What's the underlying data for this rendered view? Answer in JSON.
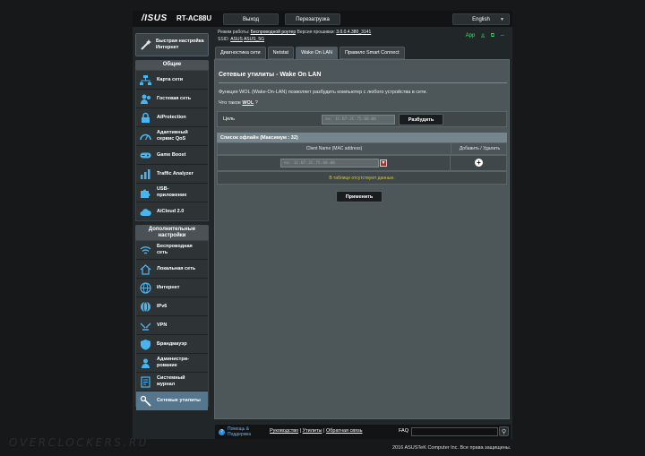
{
  "header": {
    "brand": "/ISUS",
    "model": "RT-AC88U",
    "logout_label": "Выход",
    "reboot_label": "Перезагрузка",
    "language": "English",
    "status": {
      "mode_label": "Режим работы:",
      "mode_value": "Беспроводной роутер",
      "fw_label": "Версия прошивки:",
      "fw_value": "3.0.0.4.380_3141",
      "ssid_label": "SSID:",
      "ssid_values": [
        "ASUS",
        "ASUS_5G"
      ],
      "app_label": "App"
    }
  },
  "quick_setup": {
    "label_line1": "Быстрая настройка",
    "label_line2": "Интернет"
  },
  "sidebar": {
    "general_title": "Общие",
    "general_items": [
      {
        "line1": "Карта сети",
        "line2": "",
        "icon": "network-map-icon"
      },
      {
        "line1": "Гостевая сеть",
        "line2": "",
        "icon": "guest-network-icon"
      },
      {
        "line1": "AiProtection",
        "line2": "",
        "icon": "aiprotection-lock-icon"
      },
      {
        "line1": "Адаптивный",
        "line2": "сервис QoS",
        "icon": "qos-gauge-icon"
      },
      {
        "line1": "Game Boost",
        "line2": "",
        "icon": "gamepad-icon"
      },
      {
        "line1": "Traffic Analyzer",
        "line2": "",
        "icon": "traffic-analyzer-icon"
      },
      {
        "line1": "USB-",
        "line2": "приложение",
        "icon": "usb-puzzle-icon"
      },
      {
        "line1": "AiCloud 2.0",
        "line2": "",
        "icon": "cloud-icon"
      }
    ],
    "advanced_title_line1": "Дополнительные",
    "advanced_title_line2": "настройки",
    "advanced_items": [
      {
        "line1": "Беспроводная",
        "line2": "сеть",
        "icon": "wifi-icon"
      },
      {
        "line1": "Локальная сеть",
        "line2": "",
        "icon": "home-icon"
      },
      {
        "line1": "Интернет",
        "line2": "",
        "icon": "globe-icon"
      },
      {
        "line1": "IPv6",
        "line2": "",
        "icon": "ipv6-globe-icon"
      },
      {
        "line1": "VPN",
        "line2": "",
        "icon": "vpn-icon"
      },
      {
        "line1": "Брандмауэр",
        "line2": "",
        "icon": "firewall-shield-icon"
      },
      {
        "line1": "Администри-",
        "line2": "рование",
        "icon": "admin-user-icon"
      },
      {
        "line1": "Системный",
        "line2": "журнал",
        "icon": "system-log-icon"
      },
      {
        "line1": "Сетевые утилиты",
        "line2": "",
        "icon": "network-tools-icon"
      }
    ]
  },
  "tabs": [
    "Диагностика сети",
    "Netstat",
    "Wake On LAN",
    "Правило Smart Connect"
  ],
  "main": {
    "title": "Сетевые утилиты - Wake On LAN",
    "description": "Функция WOL (Wake-On-LAN) позволяет разбудить компьютер с любого устройства в сети.",
    "wol_question_prefix": "Что такое",
    "wol_question_link": "WOL",
    "wol_question_suffix": "?",
    "target_label": "Цель",
    "target_placeholder": "ex: 1C:B7:2C:75:00:00",
    "wake_button": "Разбудить",
    "list_title": "Список офлайн (Максимум : 32)",
    "col_client": "Client Name (MAC address)",
    "col_action": "Добавить / Удалить",
    "row_placeholder": "ex: 1C:B7:2C:75:00:00",
    "empty_text": "В таблице отсутствуют данные.",
    "apply_button": "Применить"
  },
  "footer": {
    "help_line1": "Помощь &",
    "help_line2": "Поддержка",
    "link1": "Руководство",
    "sep": "|",
    "link2": "Утилиты",
    "link3": "Обратная связь",
    "faq_label": "FAQ"
  },
  "copyright": "2016 ASUSTeK Computer Inc. Все права защищены.",
  "watermark": "OVERCLOCKERS.RU"
}
